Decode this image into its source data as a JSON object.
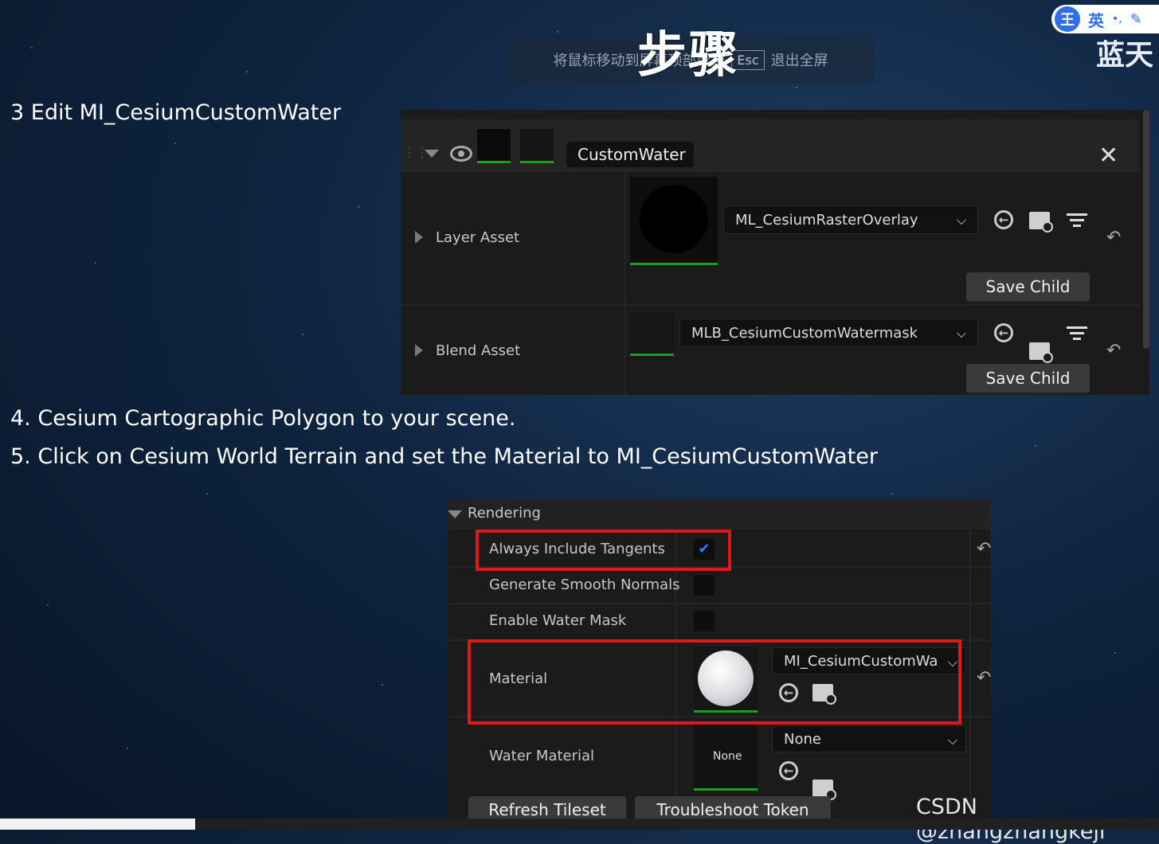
{
  "overlay": {
    "title": "步骤",
    "hint_prefix": "将鼠标移动到屏幕顶部或按",
    "hint_key": "Esc",
    "hint_suffix": "退出全屏",
    "ime_logo": "王",
    "ime_lang": "英",
    "corner_text": "蓝天"
  },
  "steps": {
    "step3": "3 Edit MI_CesiumCustomWater",
    "step4": "4. Cesium Cartographic Polygon to your scene.",
    "step5": "5. Click on Cesium World Terrain and set the Material to MI_CesiumCustomWater"
  },
  "layer_panel": {
    "layer_name": "CustomWater",
    "layer_asset_label": "Layer Asset",
    "layer_asset_value": "ML_CesiumRasterOverlay",
    "blend_asset_label": "Blend Asset",
    "blend_asset_value": "MLB_CesiumCustomWatermask",
    "save_child_label": "Save Child"
  },
  "rendering_panel": {
    "section_title": "Rendering",
    "always_include_tangents": "Always Include Tangents",
    "always_include_tangents_checked": true,
    "generate_smooth_normals": "Generate Smooth Normals",
    "generate_smooth_normals_checked": false,
    "enable_water_mask": "Enable Water Mask",
    "enable_water_mask_checked": false,
    "material_label": "Material",
    "material_value": "MI_CesiumCustomWa",
    "water_material_label": "Water Material",
    "water_material_thumb": "None",
    "water_material_value": "None",
    "refresh_tileset": "Refresh Tileset",
    "troubleshoot_token": "Troubleshoot Token"
  },
  "watermark": "CSDN @zhangzhangkeji",
  "colors": {
    "highlight_red": "#e01818",
    "ue_panel": "#1b1b1b",
    "check_blue": "#2a7cff",
    "valid_green": "#1e9e1e"
  },
  "icons": [
    "eye-icon",
    "close-icon",
    "use-selected-icon",
    "browse-icon",
    "filter-icon",
    "reset-icon",
    "checkmark-icon",
    "chevron-down-icon"
  ]
}
